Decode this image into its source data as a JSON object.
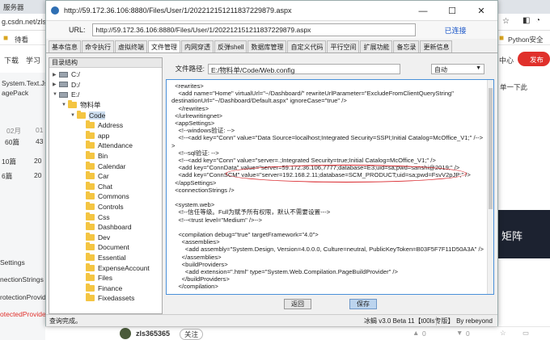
{
  "browser_bg": {
    "tab_label": "服务器",
    "address_fragment": "g.csdn.net/zls",
    "bookmark_label": "待看",
    "nav_download": "下载",
    "nav_study": "学习",
    "left_snippets": [
      "System.Text.Js",
      "agePack"
    ],
    "stats_row1": [
      "02月",
      "01"
    ],
    "stats_row2": [
      "60篇",
      "43"
    ],
    "stats_row3": [
      "10篇",
      "20"
    ],
    "stats_row4": [
      "6篇",
      "20"
    ],
    "left_settings": [
      "Settings",
      "nectionStrings",
      "rotectionProvid",
      "otectedProvide"
    ],
    "right_bookmark": "Python安全",
    "right_center": "中心",
    "publish_button": "发布",
    "right_snippet": "单一下此",
    "right_overlay": "矩阵",
    "author_name": "zls365365",
    "follow_label": "关注",
    "like_count": "0",
    "dislike_count": "0"
  },
  "window": {
    "title": "http://59.172.36.106:8880/Files/User/1/202212151211837229879.aspx",
    "url_label": "URL:",
    "url_value": "http://59.172.36.106:8880/Files/User/1/202212151211837229879.aspx",
    "connected_label": "已连接",
    "tabs": [
      "基本信息",
      "命令执行",
      "虚拟终端",
      "文件管理",
      "内网穿透",
      "反弹shell",
      "数据库管理",
      "自定义代码",
      "平行空间",
      "扩展功能",
      "备忘录",
      "更新信息"
    ],
    "active_tab": 3,
    "tree_header": "目录结构",
    "path_label": "文件路径:",
    "path_value": "E:/物料单/Code/Web.config",
    "encoding_value": "自动",
    "back_button": "返回",
    "save_button": "保存",
    "status_left": "查询完成。",
    "status_version": "冰蝎 v3.0 Beta 11【t00ls专版】",
    "status_author": "By rebeyond"
  },
  "tree": [
    {
      "label": "C:/",
      "type": "drive",
      "level": 0,
      "expanded": false
    },
    {
      "label": "D:/",
      "type": "drive",
      "level": 0,
      "expanded": false
    },
    {
      "label": "E:/",
      "type": "drive",
      "level": 0,
      "expanded": true
    },
    {
      "label": "物料单",
      "type": "folder",
      "level": 1,
      "expanded": true
    },
    {
      "label": "Code",
      "type": "folder",
      "level": 2,
      "expanded": true,
      "selected": true
    },
    {
      "label": "Address",
      "type": "folder",
      "level": 3
    },
    {
      "label": "app",
      "type": "folder",
      "level": 3
    },
    {
      "label": "Attendance",
      "type": "folder",
      "level": 3
    },
    {
      "label": "Bin",
      "type": "folder",
      "level": 3
    },
    {
      "label": "Calendar",
      "type": "folder",
      "level": 3
    },
    {
      "label": "Car",
      "type": "folder",
      "level": 3
    },
    {
      "label": "Chat",
      "type": "folder",
      "level": 3
    },
    {
      "label": "Commons",
      "type": "folder",
      "level": 3
    },
    {
      "label": "Controls",
      "type": "folder",
      "level": 3
    },
    {
      "label": "Css",
      "type": "folder",
      "level": 3
    },
    {
      "label": "Dashboard",
      "type": "folder",
      "level": 3
    },
    {
      "label": "Dev",
      "type": "folder",
      "level": 3
    },
    {
      "label": "Document",
      "type": "folder",
      "level": 3
    },
    {
      "label": "Essential",
      "type": "folder",
      "level": 3
    },
    {
      "label": "ExpenseAccount",
      "type": "folder",
      "level": 3
    },
    {
      "label": "Files",
      "type": "folder",
      "level": 3
    },
    {
      "label": "Finance",
      "type": "folder",
      "level": 3
    },
    {
      "label": "Fixedassets",
      "type": "folder",
      "level": 3
    }
  ],
  "code_lines": [
    "  <rewrites>",
    "    <add name=\"Home\" virtualUrl=\"~/Dashboard/\" rewriteUrlParameter=\"ExcludeFromClientQueryString\"",
    "destinationUrl=\"~/Dashboard/Default.aspx\" ignoreCase=\"true\" />",
    "    </rewrites>",
    "  </urlrewritingnet>",
    "  <appSettings>",
    "    <!--windows验证: -->",
    "    <!--<add key=\"Conn\" value=\"Data Source=localhost;Integrated Security=SSPI;Initial Catalog=McOffice_V1;\" /-->",
    ">",
    "    <!--sql验证: -->",
    "    <!--<add key=\"Conn\" value=\"server=.;Integrated Security=true;Initial Catalog=McOffice_V1;\" />",
    "    <add key=\"ConnData\" value=\"server=59.172.36.106,7777;database=E3;uid=sa;pwd=sanshi@2019;\" />",
    "    <add key=\"ConnSCM\" value=\"server=192.168.2.11;database=SCM_PRODUCT;uid=sa;pwd=FsvV2pJP;\" />",
    "  </appSettings>",
    "  <connectionStrings />",
    "",
    "  <system.web>",
    "    <!--信任等级。Full为赋予所有权限，默认不需要设置--->",
    "    <!--<trust level=\"Medium\" />-->",
    "",
    "    <compilation debug=\"true\" targetFramework=\"4.0\">",
    "      <assemblies>",
    "        <add assembly=\"System.Design, Version=4.0.0.0, Culture=neutral, PublicKeyToken=B03F5F7F11D50A3A\" />",
    "      </assemblies>",
    "      <buildProviders>",
    "        <add extension=\".html\" type=\"System.Web.Compilation.PageBuildProvider\" />",
    "      </buildProviders>",
    "    </compilation>",
    "",
    "    <authentication mode=\"Windows\">"
  ],
  "colors": {
    "highlight_ellipse": "#d9262b",
    "link": "#1a56c8",
    "editor_border": "#4a90d9",
    "publish_red": "#e0302b"
  }
}
